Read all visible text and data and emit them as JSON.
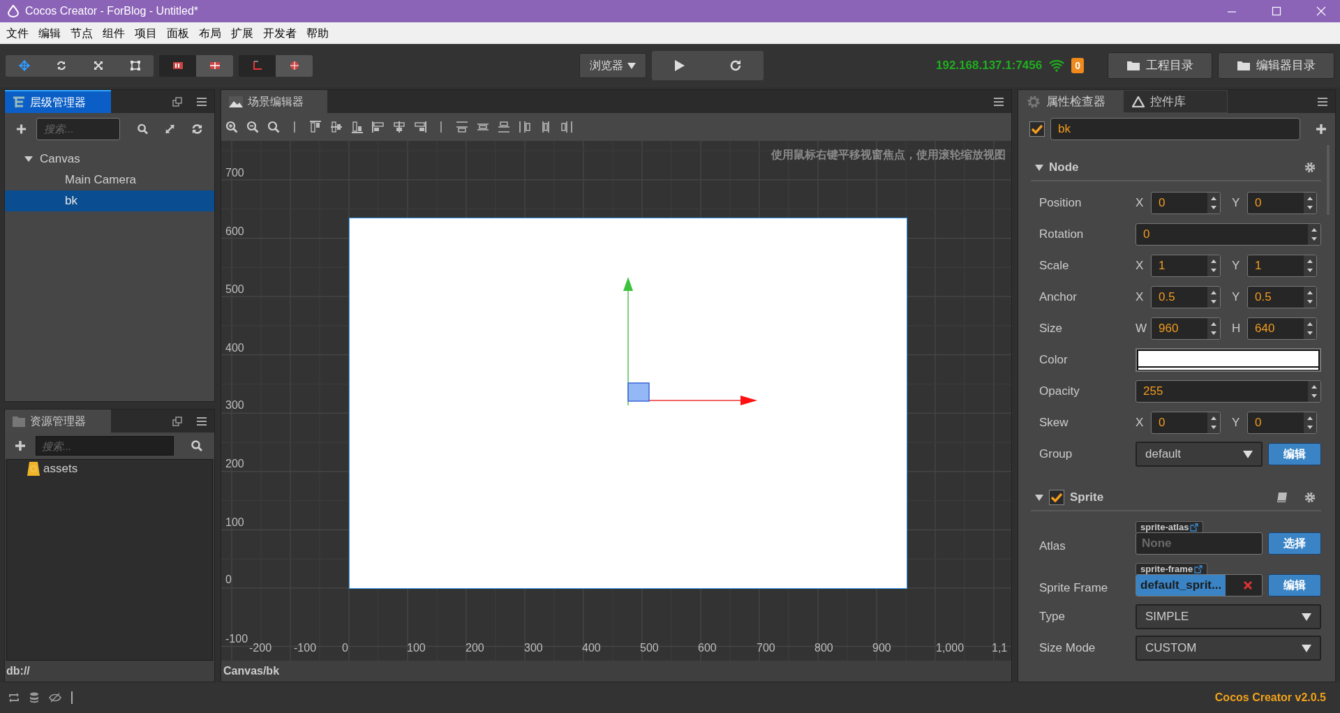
{
  "window": {
    "title": "Cocos Creator - ForBlog - Untitled*"
  },
  "menu": [
    "文件",
    "编辑",
    "节点",
    "组件",
    "项目",
    "面板",
    "布局",
    "扩展",
    "开发者",
    "帮助"
  ],
  "toolbar": {
    "transform_tools": [
      {
        "kind": "move",
        "selected": true
      },
      {
        "kind": "rotate",
        "selected": false
      },
      {
        "kind": "scale",
        "selected": false
      },
      {
        "kind": "rect",
        "selected": false
      }
    ],
    "toggles": [
      {
        "kind": "pivot",
        "on": true
      },
      {
        "kind": "center",
        "on": false
      },
      {
        "kind": "local",
        "on": true
      },
      {
        "kind": "global",
        "on": false
      }
    ],
    "preview_target": "浏览器",
    "ip": "192.168.137.1:7456",
    "badge": "0",
    "buttons": [
      "工程目录",
      "编辑器目录"
    ]
  },
  "hierarchy": {
    "tab": {
      "label": "层级管理器",
      "selected": true
    },
    "search": {
      "placeholder": "搜索..."
    },
    "tree": [
      {
        "label": "Canvas",
        "expanded": true,
        "selected": false,
        "children": [
          {
            "label": "Main Camera",
            "selected": false
          },
          {
            "label": "bk",
            "selected": true
          }
        ]
      }
    ]
  },
  "assets": {
    "tab": {
      "label": "资源管理器",
      "selected": false
    },
    "search": {
      "placeholder": "搜索..."
    },
    "tree": [
      {
        "label": "assets"
      }
    ],
    "footer": "db://"
  },
  "scene": {
    "tab": "场景编辑器",
    "hint": "使用鼠标右键平移视窗焦点，使用滚轮缩放视图",
    "y_labels": [
      "700",
      "600",
      "500",
      "400",
      "300",
      "200",
      "100",
      "0",
      "-100"
    ],
    "x_labels": [
      "-200",
      "-100",
      "0",
      "100",
      "200",
      "300",
      "400",
      "500",
      "600",
      "700",
      "800",
      "900",
      "1,000",
      "1,1"
    ],
    "footer": "Canvas/bk"
  },
  "inspector": {
    "tabs": [
      {
        "label": "属性检查器",
        "selected": true
      },
      {
        "label": "控件库",
        "selected": false
      }
    ],
    "node_enabled": true,
    "node_name": "bk",
    "sections": [
      {
        "title": "Node",
        "expanded": true,
        "props": [
          {
            "kind": "vec2",
            "label": "Position",
            "fields": [
              {
                "axis": "X",
                "value": "0"
              },
              {
                "axis": "Y",
                "value": "0"
              }
            ]
          },
          {
            "kind": "number",
            "label": "Rotation",
            "value": "0"
          },
          {
            "kind": "vec2",
            "label": "Scale",
            "fields": [
              {
                "axis": "X",
                "value": "1"
              },
              {
                "axis": "Y",
                "value": "1"
              }
            ]
          },
          {
            "kind": "vec2",
            "label": "Anchor",
            "fields": [
              {
                "axis": "X",
                "value": "0.5"
              },
              {
                "axis": "Y",
                "value": "0.5"
              }
            ]
          },
          {
            "kind": "vec2",
            "label": "Size",
            "fields": [
              {
                "axis": "W",
                "value": "960"
              },
              {
                "axis": "H",
                "value": "640"
              }
            ]
          },
          {
            "kind": "color",
            "label": "Color",
            "color": "#ffffff"
          },
          {
            "kind": "number",
            "label": "Opacity",
            "value": "255"
          },
          {
            "kind": "vec2",
            "label": "Skew",
            "fields": [
              {
                "axis": "X",
                "value": "0"
              },
              {
                "axis": "Y",
                "value": "0"
              }
            ]
          },
          {
            "kind": "select",
            "label": "Group",
            "value": "default",
            "button": "编辑"
          }
        ]
      },
      {
        "title": "Sprite",
        "expanded": true,
        "enabled": true,
        "props": [
          {
            "kind": "asset",
            "label": "Atlas",
            "tag": "sprite-atlas",
            "value": "None",
            "assigned": false,
            "button": "选择"
          },
          {
            "kind": "asset",
            "label": "Sprite Frame",
            "tag": "sprite-frame",
            "value": "default_sprit...",
            "assigned": true,
            "button": "编辑"
          },
          {
            "kind": "select",
            "label": "Type",
            "value": "SIMPLE"
          },
          {
            "kind": "select",
            "label": "Size Mode",
            "value": "CUSTOM"
          }
        ]
      }
    ]
  },
  "status_bar": {
    "version": "Cocos Creator v2.0.5"
  }
}
